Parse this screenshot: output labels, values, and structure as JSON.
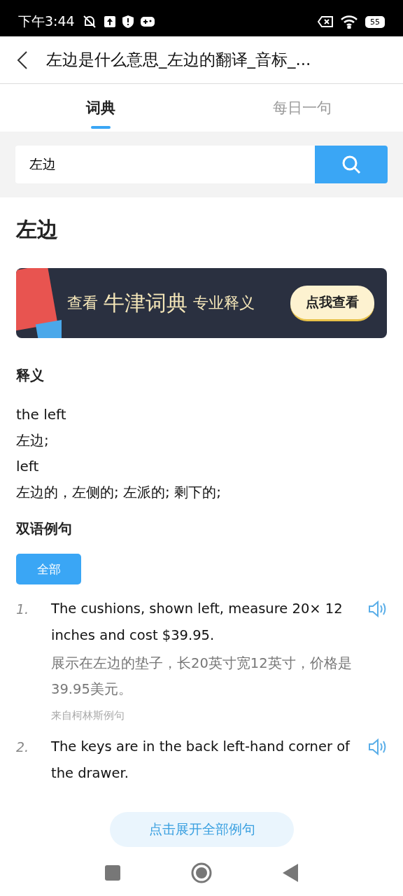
{
  "status_bar": {
    "time": "下午3:44",
    "battery": "55"
  },
  "header": {
    "title": "左边是什么意思_左边的翻译_音标_..."
  },
  "tabs": [
    {
      "label": "词典",
      "selected": true
    },
    {
      "label": "每日一句",
      "selected": false
    }
  ],
  "search": {
    "value": "左边"
  },
  "word": "左边",
  "banner": {
    "text_1": "查看",
    "text_2": "牛津词典",
    "text_3": "专业释义",
    "button": "点我查看"
  },
  "definitions": {
    "heading": "释义",
    "lines": [
      "the left",
      "左边;",
      "left",
      "左边的，左侧的; 左派的; 剩下的;"
    ]
  },
  "examples": {
    "heading": "双语例句",
    "filters": [
      {
        "label": "全部",
        "selected": true
      }
    ],
    "items": [
      {
        "number": "1.",
        "english": "The cushions, shown left, measure 20× 12 inches and cost $39.95.",
        "chinese": "展示在左边的垫子，长20英寸宽12英寸，价格是39.95美元。",
        "source": "来自柯林斯例句"
      },
      {
        "number": "2.",
        "english": "The keys are in the back left-hand corner of the drawer."
      }
    ]
  },
  "expand_button": "点击展开全部例句"
}
